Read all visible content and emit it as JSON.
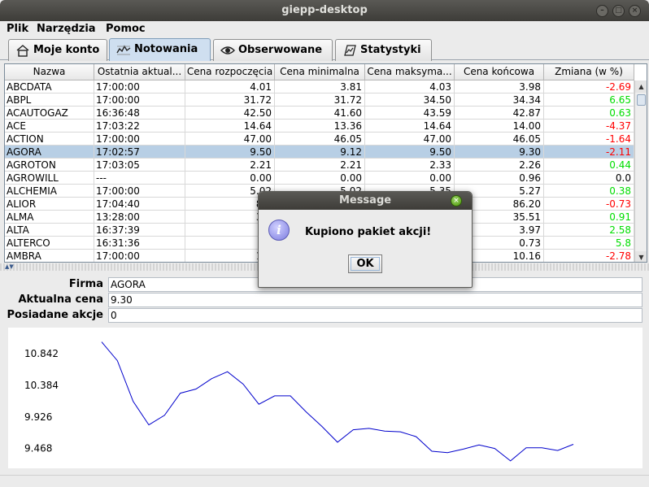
{
  "window": {
    "title": "giepp-desktop"
  },
  "menu": [
    {
      "label": "Plik",
      "left": 8
    },
    {
      "label": "Narzędzia",
      "left": 45
    },
    {
      "label": "Pomoc",
      "left": 130
    }
  ],
  "tabs": [
    {
      "label": "Moje konto",
      "icon": "house-icon",
      "left": 10,
      "width": 122,
      "active": false
    },
    {
      "label": "Notowania",
      "icon": "chart-icon",
      "left": 134,
      "width": 125,
      "active": true
    },
    {
      "label": "Obserwowane",
      "icon": "eye-icon",
      "left": 262,
      "width": 147,
      "active": false
    },
    {
      "label": "Statystyki",
      "icon": "stats-icon",
      "left": 412,
      "width": 119,
      "active": false
    }
  ],
  "table": {
    "columns": [
      "Nazwa",
      "Ostatnia aktual...",
      "Cena rozpoczęcia",
      "Cena minimalna",
      "Cena maksyma...",
      "Cena końcowa",
      "Zmiana (w %)"
    ],
    "rows": [
      [
        "ABCDATA",
        "17:00:00",
        "4.01",
        "3.81",
        "4.03",
        "3.98",
        "-2.69"
      ],
      [
        "ABPL",
        "17:00:00",
        "31.72",
        "31.72",
        "34.50",
        "34.34",
        "6.65"
      ],
      [
        "ACAUTOGAZ",
        "16:36:48",
        "42.50",
        "41.60",
        "43.59",
        "42.87",
        "0.63"
      ],
      [
        "ACE",
        "17:03:22",
        "14.64",
        "13.36",
        "14.64",
        "14.00",
        "-4.37"
      ],
      [
        "ACTION",
        "17:00:00",
        "47.00",
        "46.05",
        "47.00",
        "46.05",
        "-1.64"
      ],
      [
        "AGORA",
        "17:02:57",
        "9.50",
        "9.12",
        "9.50",
        "9.30",
        "-2.11"
      ],
      [
        "AGROTON",
        "17:03:05",
        "2.21",
        "2.21",
        "2.33",
        "2.26",
        "0.44"
      ],
      [
        "AGROWILL",
        "---",
        "0.00",
        "0.00",
        "0.00",
        "0.96",
        "0.0"
      ],
      [
        "ALCHEMIA",
        "17:00:00",
        "5.02",
        "5.02",
        "5.35",
        "5.27",
        "0.38"
      ],
      [
        "ALIOR",
        "17:04:40",
        "85.",
        "",
        "",
        "86.20",
        "-0.73"
      ],
      [
        "ALMA",
        "13:28:00",
        "35.",
        "",
        "",
        "35.51",
        "0.91"
      ],
      [
        "ALTA",
        "16:37:39",
        "3.",
        "",
        "",
        "3.97",
        "2.58"
      ],
      [
        "ALTERCO",
        "16:31:36",
        "0.",
        "",
        "",
        "0.73",
        "5.8"
      ],
      [
        "AMBRA",
        "17:00:00",
        "10.",
        "",
        "",
        "10.16",
        "-2.78"
      ]
    ],
    "selected_row": 5
  },
  "details": {
    "firma_label": "Firma",
    "firma_value": "AGORA",
    "cena_label": "Aktualna cena",
    "cena_value": "9.30",
    "akcje_label": "Posiadane akcje",
    "akcje_value": "0"
  },
  "chart_data": {
    "type": "line",
    "title": "",
    "xlabel": "",
    "ylabel": "",
    "ytick_labels": [
      "10.842",
      "10.384",
      "9.926",
      "9.468"
    ],
    "ytick_values": [
      10.842,
      10.384,
      9.926,
      9.468
    ],
    "ylim": [
      9.3,
      11.1
    ],
    "grid": false,
    "color": "#0000cc",
    "series": [
      {
        "values": [
          11.01,
          10.74,
          10.15,
          9.81,
          9.95,
          10.27,
          10.33,
          10.48,
          10.58,
          10.4,
          10.11,
          10.23,
          10.23,
          10.0,
          9.79,
          9.56,
          9.74,
          9.76,
          9.72,
          9.71,
          9.64,
          9.43,
          9.41,
          9.46,
          9.52,
          9.47,
          9.29,
          9.48,
          9.48,
          9.44,
          9.53
        ]
      }
    ]
  },
  "dialog": {
    "title": "Message",
    "message": "Kupiono pakiet akcji!",
    "ok_label": "OK"
  }
}
